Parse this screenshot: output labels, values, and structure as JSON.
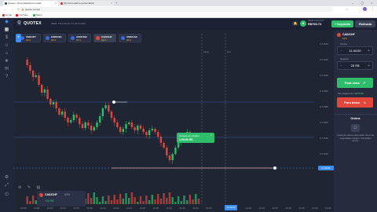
{
  "browser": {
    "tabs": [
      {
        "label": "Quotex: Uma plataforma inovad"
      },
      {
        "label": "(8) Como abrir e personalizar"
      }
    ],
    "url": "quotex.com/pt",
    "bookmarks": [
      "Gmail",
      "YouTube",
      "Maps"
    ]
  },
  "app": {
    "brand": "QUOTEX",
    "platform_label": "WEB TRADING PLATFORM",
    "assets": [
      {
        "name": "USD/JPY",
        "pct": "92%"
      },
      {
        "name": "EUR/USD",
        "pct": "92%"
      },
      {
        "name": "AUD/USD",
        "pct": "87%"
      },
      {
        "name": "CAD/CHF",
        "pct": "92%"
      },
      {
        "name": "USD/CAD",
        "pct": "92%"
      }
    ],
    "account": {
      "type": "DEMO ACCOUNT",
      "balance": "R$700.72"
    },
    "deposit_label": "+ Depósito",
    "withdraw_label": "Retirada"
  },
  "trade": {
    "pair": "CAD/CHF",
    "pair_pct": "92%",
    "time_label": "Tempo",
    "time_value": "11:34:00",
    "amount_label": "Quantia",
    "amount_value": "25 R$",
    "payout_label": "Seu pagamento:",
    "payout_value": "48,70 R$",
    "buy_label": "Para cima",
    "sell_label": "Para baixo"
  },
  "orders": {
    "title": "Ordens",
    "empty_text": "A lista de ordens está vazia. Crie uma negociação usando o formulário acima."
  },
  "chart_popup": {
    "line1": "Compra em andam.",
    "line2": "1.00:00 R$"
  },
  "chart_info": {
    "pair": "CAD/CHF",
    "payout": "92%",
    "amount": "+25 R$"
  },
  "price_ticks": [
    "0.71660",
    "0.71640",
    "0.71620",
    "0.71600",
    "0.71580",
    "0.71560",
    "0.71540",
    "0.71520",
    "0.71500"
  ],
  "time_ticks": [
    "10:58",
    "11:00",
    "11:02",
    "11:04",
    "11:06",
    "11:08",
    "11:10",
    "11:12",
    "11:14",
    "11:16",
    "11:18",
    "11:20",
    "11:22",
    "11:24",
    "11:26",
    "11:28",
    "11:30",
    "11:32",
    "11:34",
    "11:36",
    "11:38",
    "11:40",
    "11:42",
    "11:44"
  ],
  "current_price": "0.71544",
  "current_time": "11:34:00",
  "tag_start": "Início",
  "tag_end": "Fim",
  "colors": {
    "up": "#2ebd6b",
    "down": "#e3463a",
    "accent": "#3a8ef6",
    "bg": "#1f2533"
  }
}
